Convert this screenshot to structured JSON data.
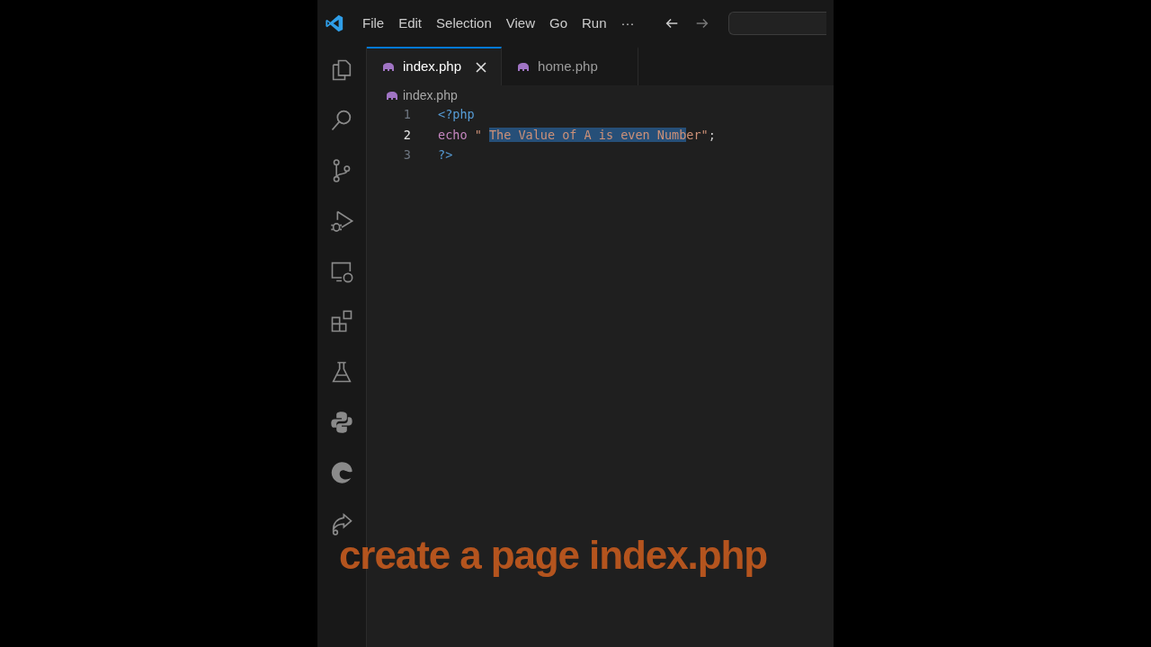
{
  "menu": [
    "File",
    "Edit",
    "Selection",
    "View",
    "Go",
    "Run",
    "···"
  ],
  "tabs": [
    {
      "label": "index.php",
      "selected": true
    },
    {
      "label": "home.php",
      "selected": false
    }
  ],
  "breadcrumb": "index.php",
  "code_lines": [
    {
      "number": "1",
      "current": false,
      "tokens": [
        {
          "kind": "tag",
          "text": "<?php"
        }
      ]
    },
    {
      "number": "2",
      "current": true,
      "tokens": [
        {
          "kind": "keyword",
          "text": "echo"
        },
        {
          "kind": "string",
          "text": " \" "
        },
        {
          "kind": "string",
          "text": "The Value of A is even Numb",
          "selected": true
        },
        {
          "kind": "string",
          "text": "er\""
        },
        {
          "kind": "plain",
          "text": ";"
        }
      ]
    },
    {
      "number": "3",
      "current": false,
      "tokens": [
        {
          "kind": "tag",
          "text": "?>"
        }
      ]
    }
  ],
  "caption": "create a page index.php"
}
